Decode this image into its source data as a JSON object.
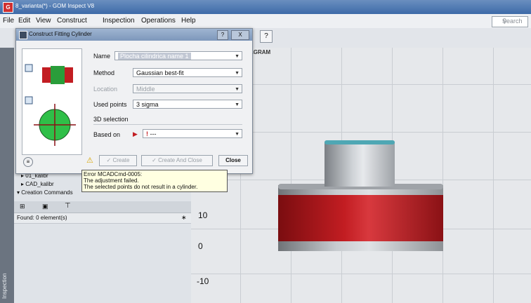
{
  "window": {
    "title": "8_varianta(*) - GOM Inspect V8"
  },
  "menu": [
    "File",
    "Edit",
    "View",
    "Construct",
    "Inspection",
    "Operations",
    "Help"
  ],
  "search": {
    "placeholder": "Search"
  },
  "toolbar": {
    "help_label": "?"
  },
  "viewport": {
    "header": "AGRAM",
    "tick_labels": [
      "10",
      "0",
      "-10"
    ]
  },
  "dialog": {
    "title": "Construct Fitting Cylinder",
    "help_label": "?",
    "close_label": "X",
    "name_label": "Name",
    "name_value": "Plocha cilindrica name 1",
    "method_label": "Method",
    "method_value": "Gaussian best-fit",
    "location_label": "Location",
    "location_value": "Middle",
    "used_points_label": "Used points",
    "used_points_value": "3 sigma",
    "section_label": "3D selection",
    "based_on_label": "Based on",
    "based_on_value": "---",
    "create_button": "Create",
    "create_close_button": "Create And Close",
    "close_button": "Close"
  },
  "error_tooltip": {
    "line1": "Error MCADCmd-0005:",
    "line2": "The adjustment failed.",
    "line3": "The selected points do not result in a cylinder."
  },
  "left_panel": {
    "tree": [
      "01_kalibr",
      "CAD_kalibr",
      "Creation Commands"
    ],
    "found_label": "Found: 0 element(s)"
  },
  "sidebar_label": "Inspection",
  "colors": {
    "accent": "#3d6aa8",
    "cylinder_red": "#c21d22",
    "teal": "#4fa7b4"
  }
}
